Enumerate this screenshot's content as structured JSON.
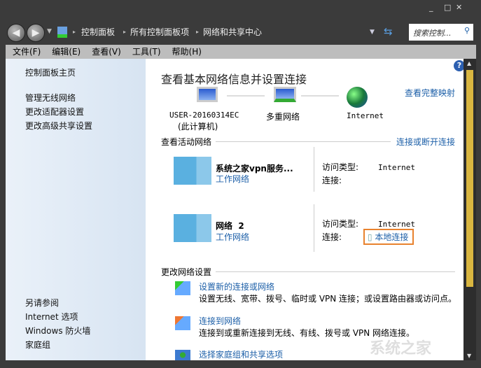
{
  "window": {
    "minimize": "_",
    "maximize": "□",
    "close": "✕"
  },
  "address": {
    "crumbs": [
      "控制面板",
      "所有控制面板项",
      "网络和共享中心"
    ],
    "search_placeholder": "搜索控制..."
  },
  "menu": [
    "文件(F)",
    "编辑(E)",
    "查看(V)",
    "工具(T)",
    "帮助(H)"
  ],
  "sidebar": {
    "home": "控制面板主页",
    "tasks": [
      "管理无线网络",
      "更改适配器设置",
      "更改高级共享设置"
    ],
    "see_also_title": "另请参阅",
    "see_also": [
      "Internet 选项",
      "Windows 防火墙",
      "家庭组"
    ]
  },
  "main": {
    "title": "查看基本网络信息并设置连接",
    "full_map": "查看完整映射",
    "map": {
      "computer": "USER-20160314EC",
      "computer_sub": "(此计算机)",
      "network": "多重网络",
      "internet": "Internet"
    },
    "active_title": "查看活动网络",
    "connect_disconnect": "连接或断开连接",
    "networks": [
      {
        "name": "系统之家vpn服务...",
        "type": "工作网络",
        "access_label": "访问类型:",
        "access": "Internet",
        "conn_label": "连接:",
        "conn": ""
      },
      {
        "name": "网络  2",
        "type": "工作网络",
        "access_label": "访问类型:",
        "access": "Internet",
        "conn_label": "连接:",
        "conn": "本地连接"
      }
    ],
    "change_title": "更改网络设置",
    "tasks": [
      {
        "title": "设置新的连接或网络",
        "desc": "设置无线、宽带、拨号、临时或 VPN 连接；或设置路由器或访问点。"
      },
      {
        "title": "连接到网络",
        "desc": "连接到或重新连接到无线、有线、拨号或 VPN 网络连接。"
      },
      {
        "title": "选择家庭组和共享选项",
        "desc": ""
      }
    ]
  },
  "watermark": "系统之家"
}
